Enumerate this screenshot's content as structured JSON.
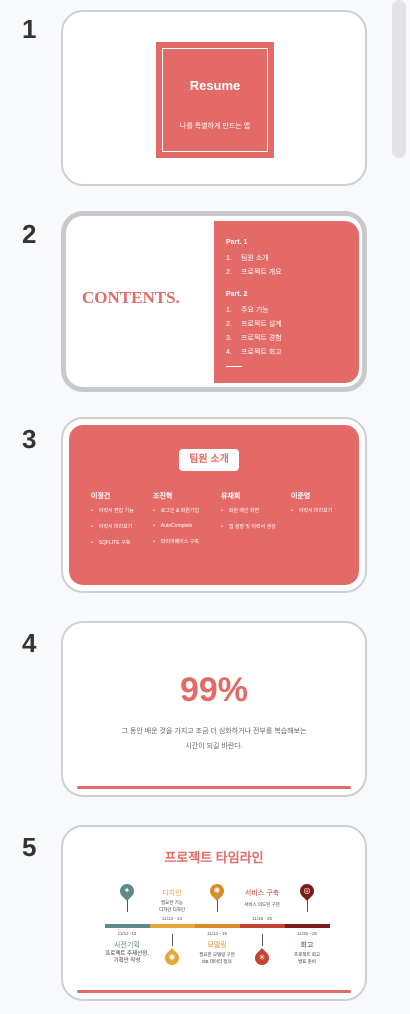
{
  "slides": [
    {
      "number": "1",
      "title": "Resume",
      "subtitle": "나를 특별하게 만드는 앱"
    },
    {
      "number": "2",
      "title": "CONTENTS.",
      "part1": {
        "label": "Part. 1",
        "items": [
          {
            "n": "1.",
            "t": "팀원 소개"
          },
          {
            "n": "2.",
            "t": "프로젝트 개요"
          }
        ]
      },
      "part2": {
        "label": "Part. 2",
        "items": [
          {
            "n": "1.",
            "t": "주요 기능"
          },
          {
            "n": "2.",
            "t": "프로젝트 설계"
          },
          {
            "n": "3.",
            "t": "프로젝트 경험"
          },
          {
            "n": "4.",
            "t": "프로젝트 회고"
          }
        ]
      }
    },
    {
      "number": "3",
      "title": "팀원 소개",
      "members": [
        {
          "name": "이정건",
          "items": [
            "이력서 편집 기능",
            "이력서 미리보기",
            "SQFLITE 구축"
          ]
        },
        {
          "name": "조진혁",
          "items": [
            "로그인 & 회원가입",
            "AutoComplete",
            "파이어베이스 구축"
          ]
        },
        {
          "name": "유재희",
          "items": [
            "회원 메인 화면",
            "앱 설정 및 이력서 생성"
          ]
        },
        {
          "name": "이준영",
          "items": [
            "이력서 미리보기"
          ]
        }
      ]
    },
    {
      "number": "4",
      "value": "99%",
      "line1": "그 동안 배운 것을 가지고 조금 더 심화하거나 전부를 복습해보는",
      "line2": "시간이 되길 바란다."
    },
    {
      "number": "5",
      "title": "프로젝트 타임라인",
      "phases": [
        {
          "label": "사전기획",
          "date": "11/12 -13",
          "desc1": "프로젝트 주제선정,",
          "desc2": "기획안 작성",
          "color": "#5f8a8b"
        },
        {
          "label": "디자인",
          "date": "11/13 - 14",
          "desc1": "필요한 기능",
          "desc2": "디자인 디자인",
          "color": "#e3a73a"
        },
        {
          "label": "모델링",
          "date": "11/14 - 15",
          "desc1": "필요한 모델링 구현",
          "desc2": "DB 데이터 정의",
          "color": "#d98b2b"
        },
        {
          "label": "서비스 구축",
          "date": "11/15 - 25",
          "desc1": "서비스 의도된 구현",
          "desc2": "",
          "color": "#c2432f"
        },
        {
          "label": "회고",
          "date": "11/25 - 26",
          "desc1": "프로젝트 회고",
          "desc2": "발표 준비",
          "color": "#7a1d1a"
        }
      ]
    }
  ],
  "colors": {
    "accent": "#e36a67"
  }
}
